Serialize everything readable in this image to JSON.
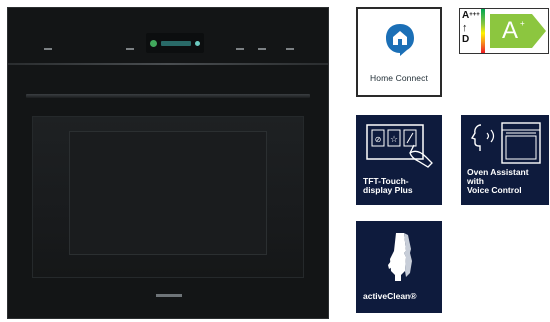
{
  "product_image": {
    "description_name": "built-in-oven"
  },
  "badges": {
    "home_connect": {
      "label": "Home Connect",
      "icon": "home-connect-icon"
    },
    "energy": {
      "scale_top": "A",
      "scale_top_sup": "+++",
      "scale_bottom": "D",
      "class": "A",
      "class_sup": "+",
      "arrow_color": "#8cc63f"
    },
    "tft": {
      "label_line1": "TFT-Touch-",
      "label_line2": "display Plus",
      "icon": "touch-display-icon"
    },
    "voice": {
      "label_line1": "Oven Assistant",
      "label_line2": "with",
      "label_line3": "Voice Control",
      "icon": "voice-control-icon"
    },
    "active_clean": {
      "label": "activeClean®",
      "icon": "glove-icon"
    }
  },
  "colors": {
    "badge_navy": "#0e1b3d",
    "home_connect_blue": "#1b6fb6",
    "display_green": "#41a85c"
  }
}
